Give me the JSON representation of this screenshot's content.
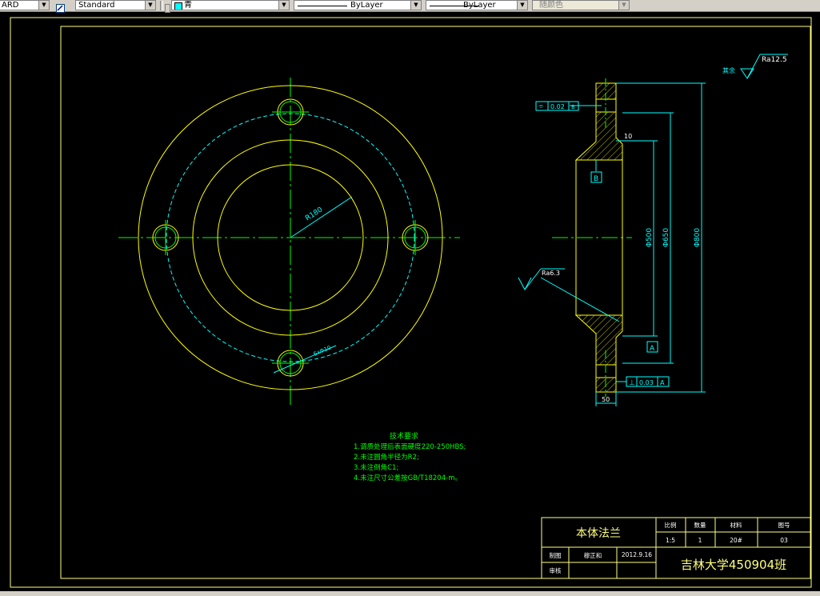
{
  "toolbar": {
    "style_combo": "ARD",
    "textstyle_combo": "Standard",
    "color_combo": "青",
    "linetype_combo": "ByLayer",
    "lineweight_combo": "ByLayer",
    "plotstyle_combo": "随颜色"
  },
  "drawing": {
    "radius_dim": "R180",
    "hole_dim": "6ⅹΦ10",
    "roughness_general_prefix": "其余",
    "roughness_general": "Ra12.5",
    "roughness_bore": "Ra6.3",
    "flatness_tol": "0.02",
    "flatness_datum": "B",
    "datum_b": "B",
    "datum_a": "A",
    "perp_tol": "0.03",
    "perp_datum": "A",
    "dim_10": "10",
    "dim_50": "50",
    "dim_d500": "Φ500",
    "dim_d650": "Φ650",
    "dim_d800": "Φ800",
    "colors": {
      "outline": "#ffff00",
      "center": "#00ff00",
      "dim": "#00ffff",
      "hatch": "#ffff00",
      "frame": "#ffff80"
    }
  },
  "notes": {
    "title": "技术要求",
    "lines": [
      "1.调质处理后表面硬度220-250HBS;",
      "2.未注圆角半径为R2;",
      "3.未注倒角C1;",
      "4.未注尺寸公差按GB/T18204-m。"
    ]
  },
  "title_block": {
    "part_name": "本体法兰",
    "h_scale": "比例",
    "h_qty": "数量",
    "h_material": "材料",
    "h_drawing_no": "图号",
    "scale": "1:5",
    "qty": "1",
    "material": "20#",
    "drawing_no": "03",
    "drawn_label": "制图",
    "drawn_by": "穆正和",
    "date": "2012.9.16",
    "checked_label": "审核",
    "school": "吉林大学450904班"
  }
}
